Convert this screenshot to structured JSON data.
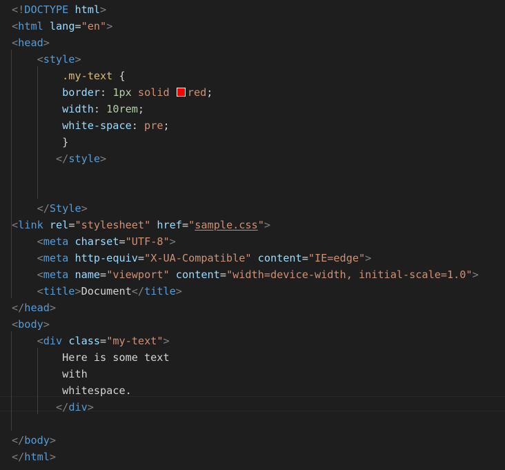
{
  "editor": {
    "lines": [
      [
        {
          "t": "<!",
          "c": "punc"
        },
        {
          "t": "DOCTYPE",
          "c": "tag"
        },
        {
          "t": " ",
          "c": "text"
        },
        {
          "t": "html",
          "c": "attr"
        },
        {
          "t": ">",
          "c": "punc"
        }
      ],
      [
        {
          "t": "<",
          "c": "punc"
        },
        {
          "t": "html",
          "c": "tag"
        },
        {
          "t": " ",
          "c": "text"
        },
        {
          "t": "lang",
          "c": "attr"
        },
        {
          "t": "=",
          "c": "text"
        },
        {
          "t": "\"en\"",
          "c": "str"
        },
        {
          "t": ">",
          "c": "punc"
        }
      ],
      [
        {
          "t": "<",
          "c": "punc"
        },
        {
          "t": "head",
          "c": "tag"
        },
        {
          "t": ">",
          "c": "punc"
        }
      ],
      [
        {
          "t": "    ",
          "c": "text"
        },
        {
          "t": "<",
          "c": "punc"
        },
        {
          "t": "style",
          "c": "tag"
        },
        {
          "t": ">",
          "c": "punc"
        }
      ],
      [
        {
          "t": "        ",
          "c": "text"
        },
        {
          "t": ".my-text",
          "c": "sel"
        },
        {
          "t": " {",
          "c": "text"
        }
      ],
      [
        {
          "t": "        ",
          "c": "text"
        },
        {
          "t": "border",
          "c": "prop"
        },
        {
          "t": ": ",
          "c": "text"
        },
        {
          "t": "1px",
          "c": "num"
        },
        {
          "t": " ",
          "c": "text"
        },
        {
          "t": "solid",
          "c": "val"
        },
        {
          "t": " ",
          "c": "text"
        },
        {
          "t": "",
          "c": "swatch"
        },
        {
          "t": "red",
          "c": "val"
        },
        {
          "t": ";",
          "c": "text"
        }
      ],
      [
        {
          "t": "        ",
          "c": "text"
        },
        {
          "t": "width",
          "c": "prop"
        },
        {
          "t": ": ",
          "c": "text"
        },
        {
          "t": "10rem",
          "c": "num"
        },
        {
          "t": ";",
          "c": "text"
        }
      ],
      [
        {
          "t": "        ",
          "c": "text"
        },
        {
          "t": "white-space",
          "c": "prop"
        },
        {
          "t": ": ",
          "c": "text"
        },
        {
          "t": "pre",
          "c": "val"
        },
        {
          "t": ";",
          "c": "text"
        }
      ],
      [
        {
          "t": "        ",
          "c": "text"
        },
        {
          "t": "}",
          "c": "text"
        }
      ],
      [
        {
          "t": "       ",
          "c": "text"
        },
        {
          "t": "</",
          "c": "punc"
        },
        {
          "t": "style",
          "c": "tag"
        },
        {
          "t": ">",
          "c": "punc"
        }
      ],
      [],
      [],
      [
        {
          "t": "    ",
          "c": "text"
        },
        {
          "t": "</",
          "c": "punc"
        },
        {
          "t": "Style",
          "c": "tag"
        },
        {
          "t": ">",
          "c": "punc"
        }
      ],
      [
        {
          "t": "<",
          "c": "punc"
        },
        {
          "t": "link",
          "c": "tag"
        },
        {
          "t": " ",
          "c": "text"
        },
        {
          "t": "rel",
          "c": "attr"
        },
        {
          "t": "=",
          "c": "text"
        },
        {
          "t": "\"stylesheet\"",
          "c": "str"
        },
        {
          "t": " ",
          "c": "text"
        },
        {
          "t": "href",
          "c": "attr"
        },
        {
          "t": "=",
          "c": "text"
        },
        {
          "t": "\"",
          "c": "str"
        },
        {
          "t": "sample.css",
          "c": "str ul"
        },
        {
          "t": "\"",
          "c": "str"
        },
        {
          "t": ">",
          "c": "punc"
        }
      ],
      [
        {
          "t": "    ",
          "c": "text"
        },
        {
          "t": "<",
          "c": "punc"
        },
        {
          "t": "meta",
          "c": "tag"
        },
        {
          "t": " ",
          "c": "text"
        },
        {
          "t": "charset",
          "c": "attr"
        },
        {
          "t": "=",
          "c": "text"
        },
        {
          "t": "\"UTF-8\"",
          "c": "str"
        },
        {
          "t": ">",
          "c": "punc"
        }
      ],
      [
        {
          "t": "    ",
          "c": "text"
        },
        {
          "t": "<",
          "c": "punc"
        },
        {
          "t": "meta",
          "c": "tag"
        },
        {
          "t": " ",
          "c": "text"
        },
        {
          "t": "http-equiv",
          "c": "attr"
        },
        {
          "t": "=",
          "c": "text"
        },
        {
          "t": "\"X-UA-Compatible\"",
          "c": "str"
        },
        {
          "t": " ",
          "c": "text"
        },
        {
          "t": "content",
          "c": "attr"
        },
        {
          "t": "=",
          "c": "text"
        },
        {
          "t": "\"IE=edge\"",
          "c": "str"
        },
        {
          "t": ">",
          "c": "punc"
        }
      ],
      [
        {
          "t": "    ",
          "c": "text"
        },
        {
          "t": "<",
          "c": "punc"
        },
        {
          "t": "meta",
          "c": "tag"
        },
        {
          "t": " ",
          "c": "text"
        },
        {
          "t": "name",
          "c": "attr"
        },
        {
          "t": "=",
          "c": "text"
        },
        {
          "t": "\"viewport\"",
          "c": "str"
        },
        {
          "t": " ",
          "c": "text"
        },
        {
          "t": "content",
          "c": "attr"
        },
        {
          "t": "=",
          "c": "text"
        },
        {
          "t": "\"width=device-width, initial-scale=1.0\"",
          "c": "str"
        },
        {
          "t": ">",
          "c": "punc"
        }
      ],
      [
        {
          "t": "    ",
          "c": "text"
        },
        {
          "t": "<",
          "c": "punc"
        },
        {
          "t": "title",
          "c": "tag"
        },
        {
          "t": ">",
          "c": "punc"
        },
        {
          "t": "Document",
          "c": "text"
        },
        {
          "t": "</",
          "c": "punc"
        },
        {
          "t": "title",
          "c": "tag"
        },
        {
          "t": ">",
          "c": "punc"
        }
      ],
      [
        {
          "t": "</",
          "c": "punc"
        },
        {
          "t": "head",
          "c": "tag"
        },
        {
          "t": ">",
          "c": "punc"
        }
      ],
      [
        {
          "t": "<",
          "c": "punc"
        },
        {
          "t": "body",
          "c": "tag"
        },
        {
          "t": ">",
          "c": "punc"
        }
      ],
      [
        {
          "t": "    ",
          "c": "text"
        },
        {
          "t": "<",
          "c": "punc"
        },
        {
          "t": "div",
          "c": "tag"
        },
        {
          "t": " ",
          "c": "text"
        },
        {
          "t": "class",
          "c": "attr"
        },
        {
          "t": "=",
          "c": "text"
        },
        {
          "t": "\"my-text\"",
          "c": "str"
        },
        {
          "t": ">",
          "c": "punc"
        }
      ],
      [
        {
          "t": "        ",
          "c": "text"
        },
        {
          "t": "Here is some text",
          "c": "text"
        }
      ],
      [
        {
          "t": "        ",
          "c": "text"
        },
        {
          "t": "with",
          "c": "text"
        }
      ],
      [
        {
          "t": "        ",
          "c": "text"
        },
        {
          "t": "whitespace.",
          "c": "text"
        }
      ],
      [
        {
          "t": "       ",
          "c": "text"
        },
        {
          "t": "</",
          "c": "punc"
        },
        {
          "t": "div",
          "c": "tag"
        },
        {
          "t": ">",
          "c": "punc"
        }
      ],
      [],
      [
        {
          "t": "</",
          "c": "punc"
        },
        {
          "t": "body",
          "c": "tag"
        },
        {
          "t": ">",
          "c": "punc"
        }
      ],
      [
        {
          "t": "</",
          "c": "punc"
        },
        {
          "t": "html",
          "c": "tag"
        },
        {
          "t": ">",
          "c": "punc"
        }
      ]
    ]
  }
}
